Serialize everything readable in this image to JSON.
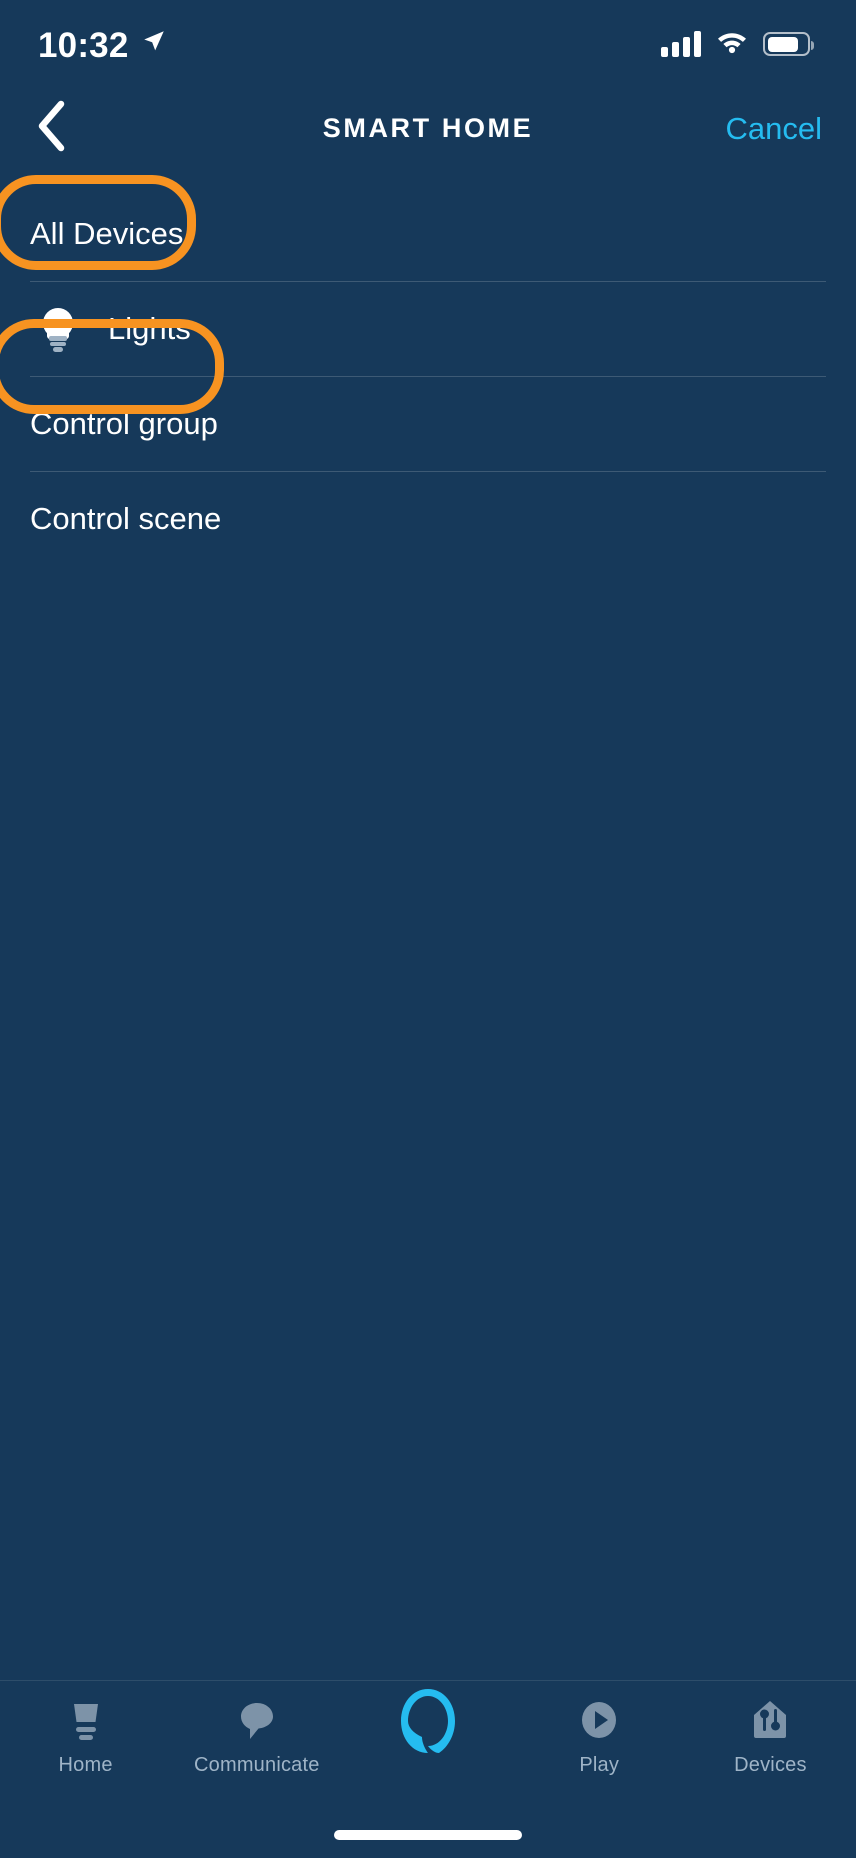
{
  "colors": {
    "background": "#16395a",
    "accent_cyan": "#25bcf0",
    "annotation_orange": "#f79321",
    "tab_inactive": "#9fb4c7",
    "divider": "rgba(255,255,255,0.17)"
  },
  "status_bar": {
    "time": "10:32",
    "location_icon": "location-arrow-icon",
    "cellular_icon": "cellular-signal-icon",
    "cellular_bars": 4,
    "wifi_icon": "wifi-icon",
    "battery_icon": "battery-icon",
    "battery_level_percent": 72
  },
  "header": {
    "back_icon": "chevron-left-icon",
    "title": "SMART HOME",
    "cancel_label": "Cancel"
  },
  "list": {
    "rows": [
      {
        "label": "All Devices",
        "icon": null,
        "highlighted": true
      },
      {
        "label": "Lights",
        "icon": "light-bulb-icon",
        "highlighted": true
      },
      {
        "label": "Control group",
        "icon": null,
        "highlighted": false
      },
      {
        "label": "Control scene",
        "icon": null,
        "highlighted": false
      }
    ]
  },
  "annotations": [
    {
      "name": "all-devices-highlight",
      "target": "All Devices"
    },
    {
      "name": "lights-highlight",
      "target": "Lights"
    }
  ],
  "tab_bar": {
    "tabs": [
      {
        "label": "Home",
        "icon": "echo-device-icon",
        "active": false
      },
      {
        "label": "Communicate",
        "icon": "speech-bubble-icon",
        "active": false
      },
      {
        "label": "",
        "icon": "alexa-ring-icon",
        "active": true
      },
      {
        "label": "Play",
        "icon": "play-circle-icon",
        "active": false
      },
      {
        "label": "Devices",
        "icon": "house-sliders-icon",
        "active": false
      }
    ]
  },
  "home_indicator": {
    "name": "home-indicator"
  }
}
